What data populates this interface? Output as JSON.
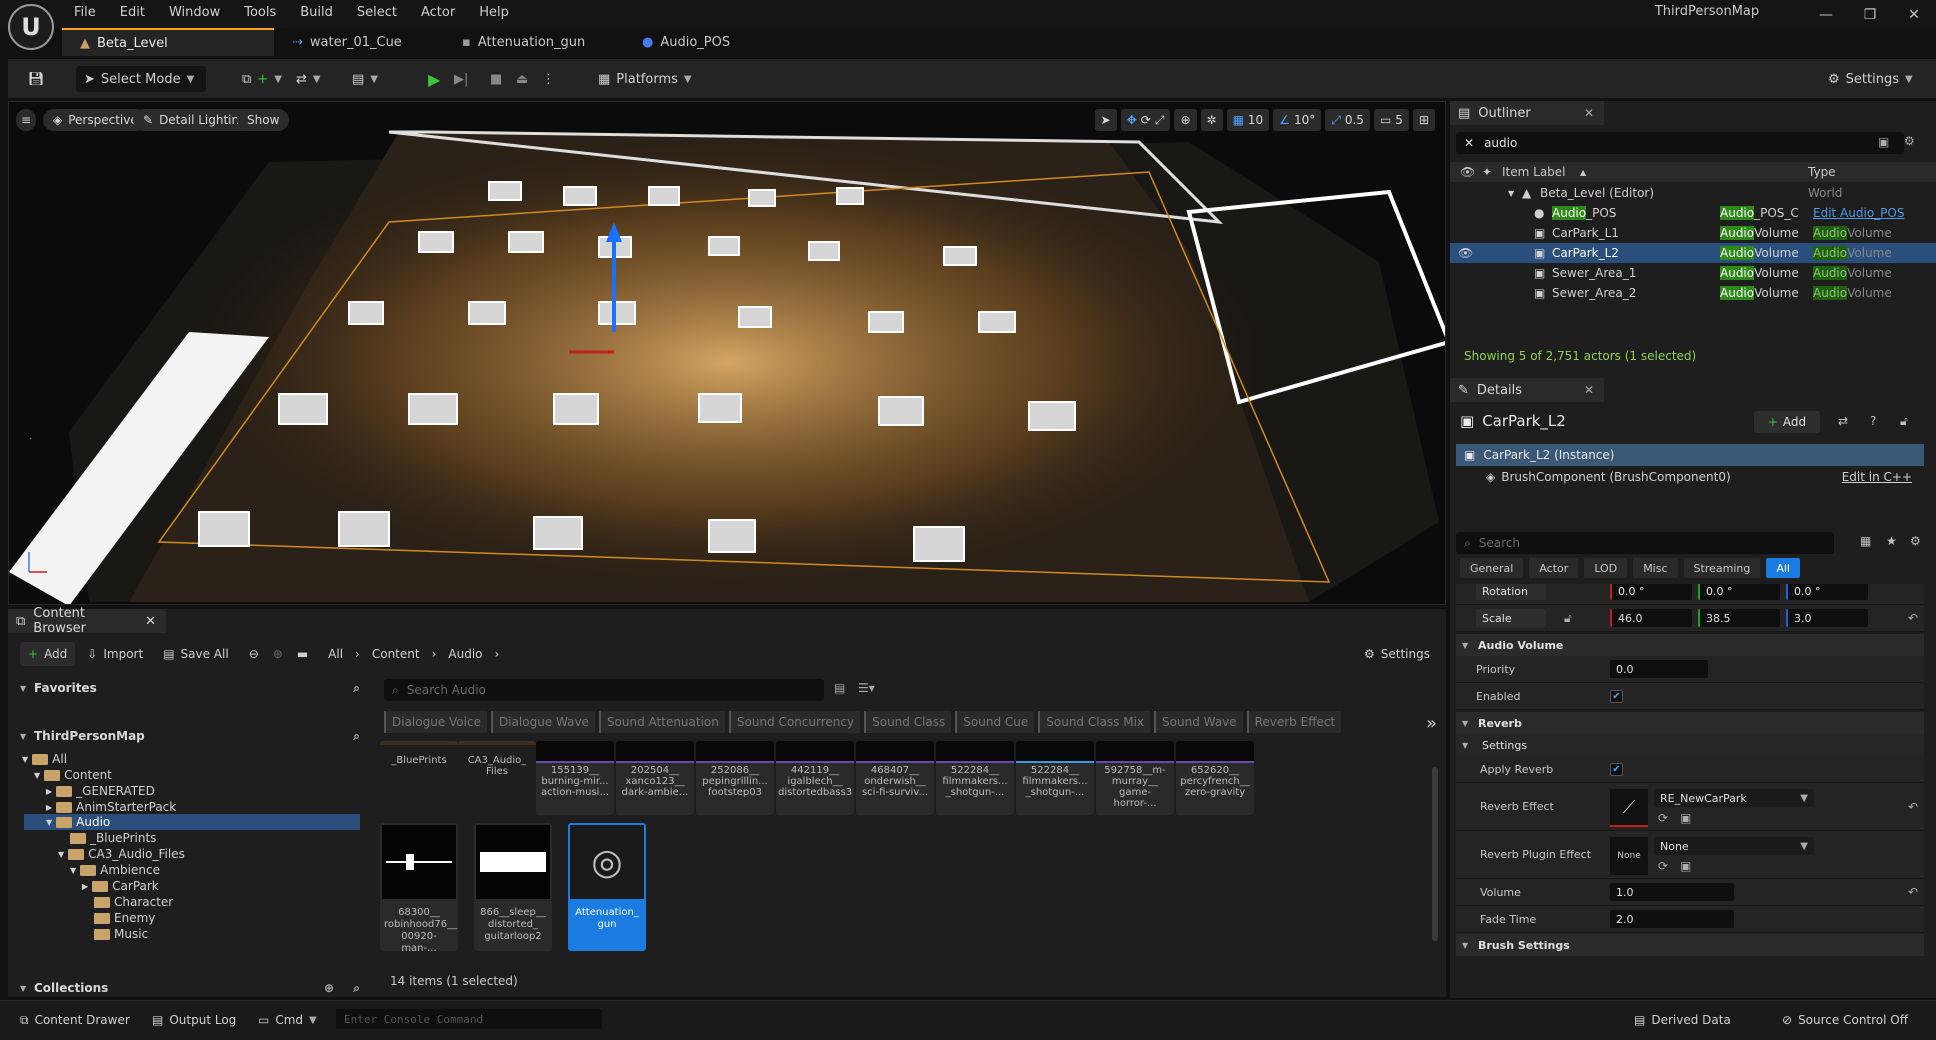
{
  "menu": [
    "File",
    "Edit",
    "Window",
    "Tools",
    "Build",
    "Select",
    "Actor",
    "Help"
  ],
  "window_title": "ThirdPersonMap",
  "doc_tabs": [
    "Beta_Level",
    "water_01_Cue",
    "Attenuation_gun",
    "Audio_POS"
  ],
  "toolbar": {
    "select_mode": "Select Mode",
    "platforms": "Platforms",
    "settings": "Settings"
  },
  "viewport": {
    "perspective": "Perspective",
    "lighting": "Detail Lighting",
    "show": "Show",
    "grid_snap": "10",
    "rot_snap": "10°",
    "scale_snap": "0.5",
    "cam_speed": "5"
  },
  "outliner": {
    "tab": "Outliner",
    "search": "audio",
    "col_label": "Item Label",
    "col_type": "Type",
    "root": "Beta_Level (Editor)",
    "root_type": "World",
    "rows": [
      {
        "hl": "Audio",
        "rest": "_POS",
        "type_hl": "Audio",
        "type_rest": "_POS_C",
        "link": "Edit Audio_POS"
      },
      {
        "name": "CarPark_L1",
        "type_hl": "Audio",
        "type_rest": "Volume",
        "t2_hl": "Audio",
        "t2_rest": "Volume"
      },
      {
        "name": "CarPark_L2",
        "type_hl": "Audio",
        "type_rest": "Volume",
        "t2_hl": "Audio",
        "t2_rest": "Volume"
      },
      {
        "name": "Sewer_Area_1",
        "type_hl": "Audio",
        "type_rest": "Volume",
        "t2_hl": "Audio",
        "t2_rest": "Volume"
      },
      {
        "name": "Sewer_Area_2",
        "type_hl": "Audio",
        "type_rest": "Volume",
        "t2_hl": "Audio",
        "t2_rest": "Volume"
      }
    ],
    "status": "Showing 5 of 2,751 actors (1 selected)"
  },
  "details": {
    "tab": "Details",
    "title": "CarPark_L2",
    "add": "Add",
    "instance": "CarPark_L2 (Instance)",
    "brush": "BrushComponent (BrushComponent0)",
    "edit_cpp": "Edit in C++",
    "search_placeholder": "Search",
    "categories": [
      "General",
      "Actor",
      "LOD",
      "Misc",
      "Streaming",
      "All"
    ],
    "rotation": "Rotation",
    "rot_x": "0.0 °",
    "rot_y": "0.0 °",
    "rot_z": "0.0 °",
    "scale": "Scale",
    "scale_x": "46.0",
    "scale_y": "38.5",
    "scale_z": "3.0",
    "sect_audio_volume": "Audio Volume",
    "priority_label": "Priority",
    "priority": "0.0",
    "enabled_label": "Enabled",
    "sect_reverb": "Reverb",
    "sect_settings": "Settings",
    "apply_reverb": "Apply Reverb",
    "reverb_effect_label": "Reverb Effect",
    "reverb_effect": "RE_NewCarPark",
    "reverb_plugin_label": "Reverb Plugin Effect",
    "reverb_plugin": "None",
    "none_thumb": "None",
    "volume_label": "Volume",
    "volume": "1.0",
    "fade_label": "Fade Time",
    "fade": "2.0",
    "sect_brush": "Brush Settings"
  },
  "content_browser": {
    "tab": "Content Browser",
    "add": "Add",
    "import": "Import",
    "save_all": "Save All",
    "crumbs": [
      "All",
      "Content",
      "Audio"
    ],
    "settings": "Settings",
    "favorites": "Favorites",
    "project": "ThirdPersonMap",
    "collections": "Collections",
    "tree": [
      "All",
      "Content",
      "_GENERATED",
      "AnimStarterPack",
      "Audio",
      "_BluePrints",
      "CA3_Audio_Files",
      "Ambience",
      "CarPark",
      "Character",
      "Enemy",
      "Music"
    ],
    "search_placeholder": "Search Audio",
    "filters": [
      "Dialogue Voice",
      "Dialogue Wave",
      "Sound Attenuation",
      "Sound Concurrency",
      "Sound Class",
      "Sound Cue",
      "Sound Class Mix",
      "Sound Wave",
      "Reverb Effect"
    ],
    "row1": [
      "_BluePrints",
      "CA3_Audio_ Files",
      "155139__ burning-mir... action-musi...",
      "202504__ xanco123__ dark-ambie...",
      "252086__ pepingrillin... footstep03",
      "442119__ igalblech__ distortedbass3",
      "468407__ onderwish__ sci-fi-surviv...",
      "522284__ filmmakers... _shotgun-...",
      "522284__ filmmakers... _shotgun-...",
      "592758__m- murray__ game-horror-...",
      "652620__ percyfrench__ zero-gravity"
    ],
    "row2": [
      "68300__ robinhood76__ 00920-man-...",
      "866__sleep__ distorted_ guitarloop2",
      "Attenuation_ gun"
    ],
    "count": "14 items (1 selected)"
  },
  "statusbar": {
    "drawer": "Content Drawer",
    "output": "Output Log",
    "cmd": "Cmd",
    "console_placeholder": "Enter Console Command",
    "derived": "Derived Data",
    "scc": "Source Control Off"
  }
}
